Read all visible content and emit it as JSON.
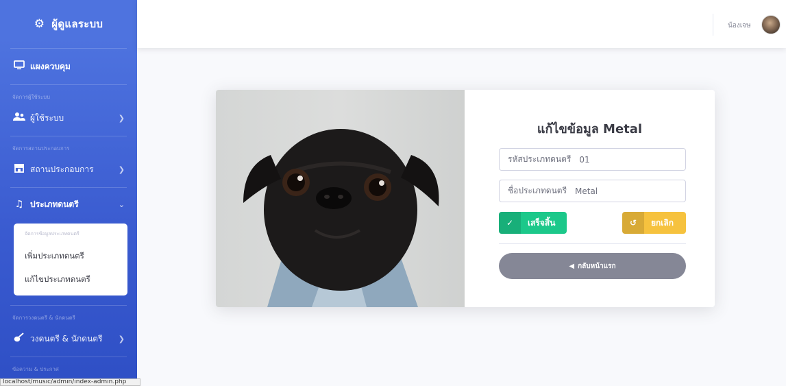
{
  "sidebar": {
    "brand": {
      "icon": "user-cog-icon",
      "title": "ผู้ดูแลระบบ"
    },
    "dashboard": {
      "icon": "monitor-icon",
      "label": "แผงควบคุม"
    },
    "sections": [
      {
        "heading": "จัดการผู้ใช้ระบบ",
        "item": {
          "icon": "users-icon",
          "label": "ผู้ใช้ระบบ"
        }
      },
      {
        "heading": "จัดการสถานประกอบการ",
        "item": {
          "icon": "store-icon",
          "label": "สถานประกอบการ"
        }
      },
      {
        "item": {
          "icon": "music-icon",
          "label": "ประเภทดนตรี"
        },
        "submenu": {
          "heading": "จัดการข้อมูลประเภทดนตรี",
          "items": [
            "เพิ่มประเภทดนตรี",
            "แก้ไขประเภทดนตรี"
          ]
        }
      },
      {
        "heading": "จัดการวงดนตรี & นักดนตรี",
        "item": {
          "icon": "guitar-icon",
          "label": "วงดนตรี & นักดนตรี"
        }
      },
      {
        "heading": "ข้อความ & ประกาศ"
      }
    ]
  },
  "topbar": {
    "user_name": "น้องเจษ"
  },
  "form": {
    "title": "แก้ไขข้อมูล Metal",
    "id_label": "รหัสประเภทดนตรี",
    "id_value": "01",
    "name_label": "ชื่อประเภทดนตรี",
    "name_value": "Metal",
    "submit_label": "เสร็จสิ้น",
    "cancel_label": "ยกเลิก",
    "back_label": "กลับหน้าแรก"
  },
  "statusbar": {
    "url": "localhost/music/admin/index-admin.php"
  },
  "colors": {
    "primary": "#4e73df",
    "success": "#1cc88a",
    "warning": "#f6c23e",
    "secondary": "#858796"
  }
}
